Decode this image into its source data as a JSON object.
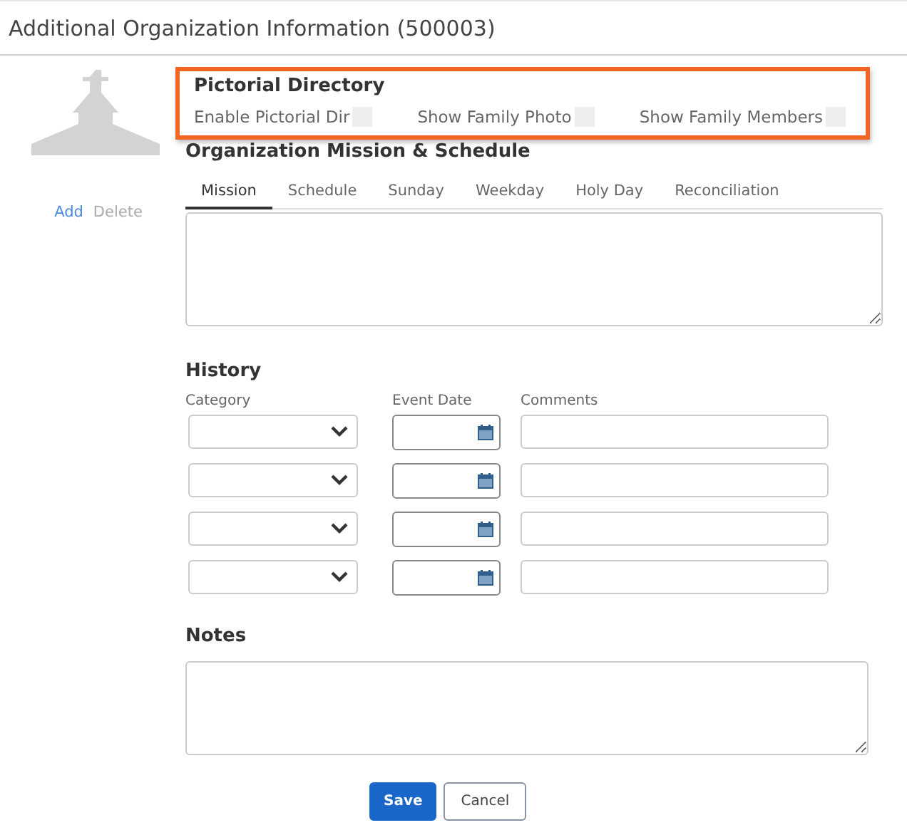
{
  "window": {
    "title": "Additional Organization Information (500003)"
  },
  "photo": {
    "actions": [
      {
        "label": "Add",
        "disabled": false
      },
      {
        "label": "Delete",
        "disabled": true
      }
    ]
  },
  "pictorial_directory": {
    "title": "Pictorial Directory",
    "checkboxes": [
      {
        "label": "Enable Pictorial Dir",
        "checked": false
      },
      {
        "label": "Show Family Photo",
        "checked": false
      },
      {
        "label": "Show Family Members",
        "checked": false
      }
    ]
  },
  "mission": {
    "title": "Organization Mission & Schedule",
    "tabs": [
      {
        "label": "Mission",
        "selected": true
      },
      {
        "label": "Schedule",
        "selected": false
      },
      {
        "label": "Sunday",
        "selected": false
      },
      {
        "label": "Weekday",
        "selected": false
      },
      {
        "label": "Holy Day",
        "selected": false
      },
      {
        "label": "Reconciliation",
        "selected": false
      }
    ]
  },
  "history": {
    "title": "History",
    "columns": [
      "Category",
      "Event Date",
      "Comments"
    ],
    "rows": [
      {
        "kind": "entry"
      },
      {
        "kind": "entry"
      },
      {
        "kind": "entry"
      },
      {
        "kind": "entry"
      }
    ]
  },
  "notes": {
    "title": "Notes"
  },
  "buttons": [
    {
      "label": "Save",
      "kind": "primary"
    },
    {
      "label": "Cancel",
      "kind": "secondary"
    }
  ]
}
